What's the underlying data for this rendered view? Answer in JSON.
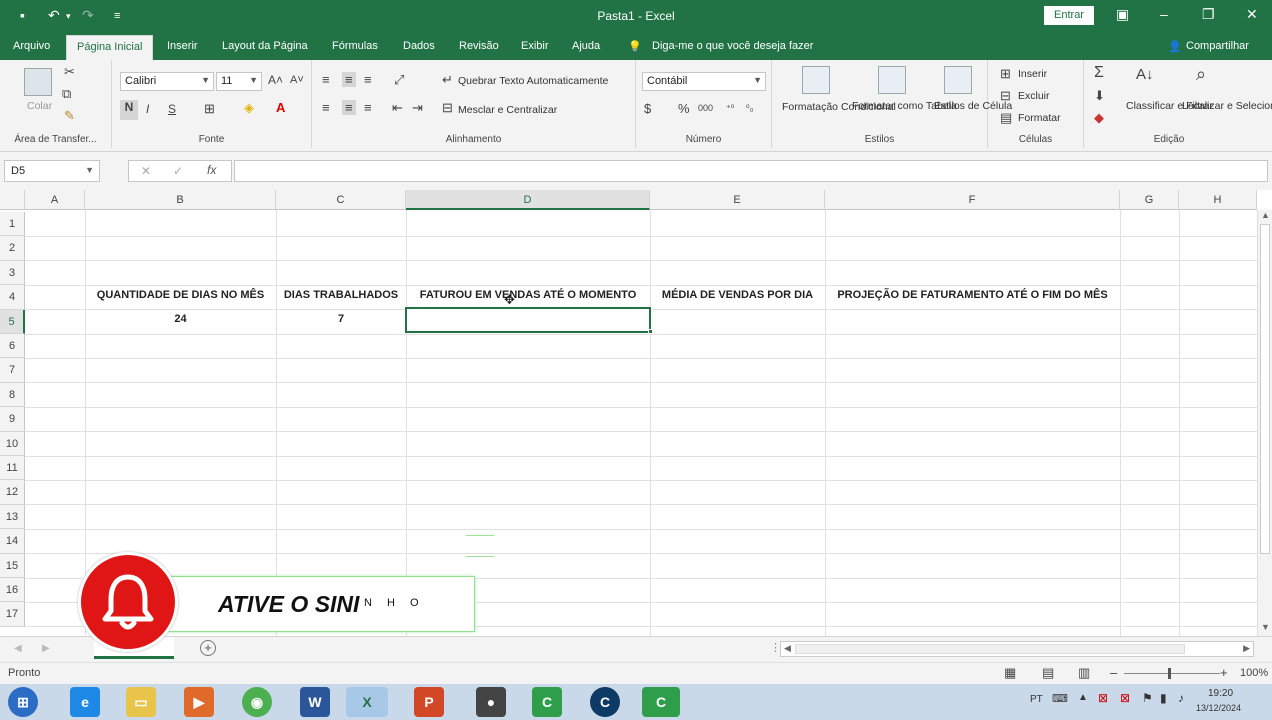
{
  "window": {
    "title": "Pasta1 - Excel",
    "signin_label": "Entrar"
  },
  "ribbon_tabs": [
    "Arquivo",
    "Página Inicial",
    "Inserir",
    "Layout da Página",
    "Fórmulas",
    "Dados",
    "Revisão",
    "Exibir",
    "Ajuda"
  ],
  "tell_me": "Diga-me o que você deseja fazer",
  "share_label": "Compartilhar",
  "clipboard": {
    "paste_label": "Colar",
    "group_label": "Área de Transfer..."
  },
  "font": {
    "name": "Calibri",
    "size": "11",
    "bold": "N",
    "italic": "I",
    "underline": "S",
    "group_label": "Fonte"
  },
  "alignment": {
    "wrap_label": "Quebrar Texto Automaticamente",
    "merge_label": "Mesclar e Centralizar",
    "group_label": "Alinhamento"
  },
  "number": {
    "format": "Contábil",
    "group_label": "Número"
  },
  "styles": {
    "conditional_label": "Formatação Condicional",
    "table_label": "Formatar como Tabela",
    "cell_styles_label": "Estilos de Célula",
    "group_label": "Estilos"
  },
  "cells": {
    "insert_label": "Inserir",
    "delete_label": "Excluir",
    "format_label": "Formatar",
    "group_label": "Células"
  },
  "editing": {
    "sort_label": "Classificar e Filtrar",
    "find_label": "Localizar e Selecionar",
    "group_label": "Edição"
  },
  "formula_bar": {
    "name_box": "D5",
    "fx": "fx",
    "formula": ""
  },
  "columns": [
    "A",
    "B",
    "C",
    "D",
    "E",
    "F",
    "G",
    "H"
  ],
  "rows": [
    "1",
    "2",
    "3",
    "4",
    "5",
    "6",
    "7",
    "8",
    "9",
    "10",
    "11",
    "12",
    "13",
    "14",
    "15",
    "16",
    "17"
  ],
  "cells_data": {
    "B4": "QUANTIDADE DE DIAS NO MÊS",
    "C4": "DIAS TRABALHADOS",
    "D4": "FATUROU EM VENDAS ATÉ O MOMENTO",
    "E4": "MÉDIA DE VENDAS POR DIA",
    "F4": "PROJEÇÃO DE FATURAMENTO ATÉ O FIM DO MÊS",
    "B5": "24",
    "C5": "7"
  },
  "overlay": {
    "banner_text": "ATIVE O SINI",
    "banner_small": "N H O"
  },
  "status": {
    "ready": "Pronto",
    "zoom": "100%"
  },
  "taskbar": {
    "lang": "PT",
    "time": "19:20",
    "date": "13/12/2024"
  }
}
